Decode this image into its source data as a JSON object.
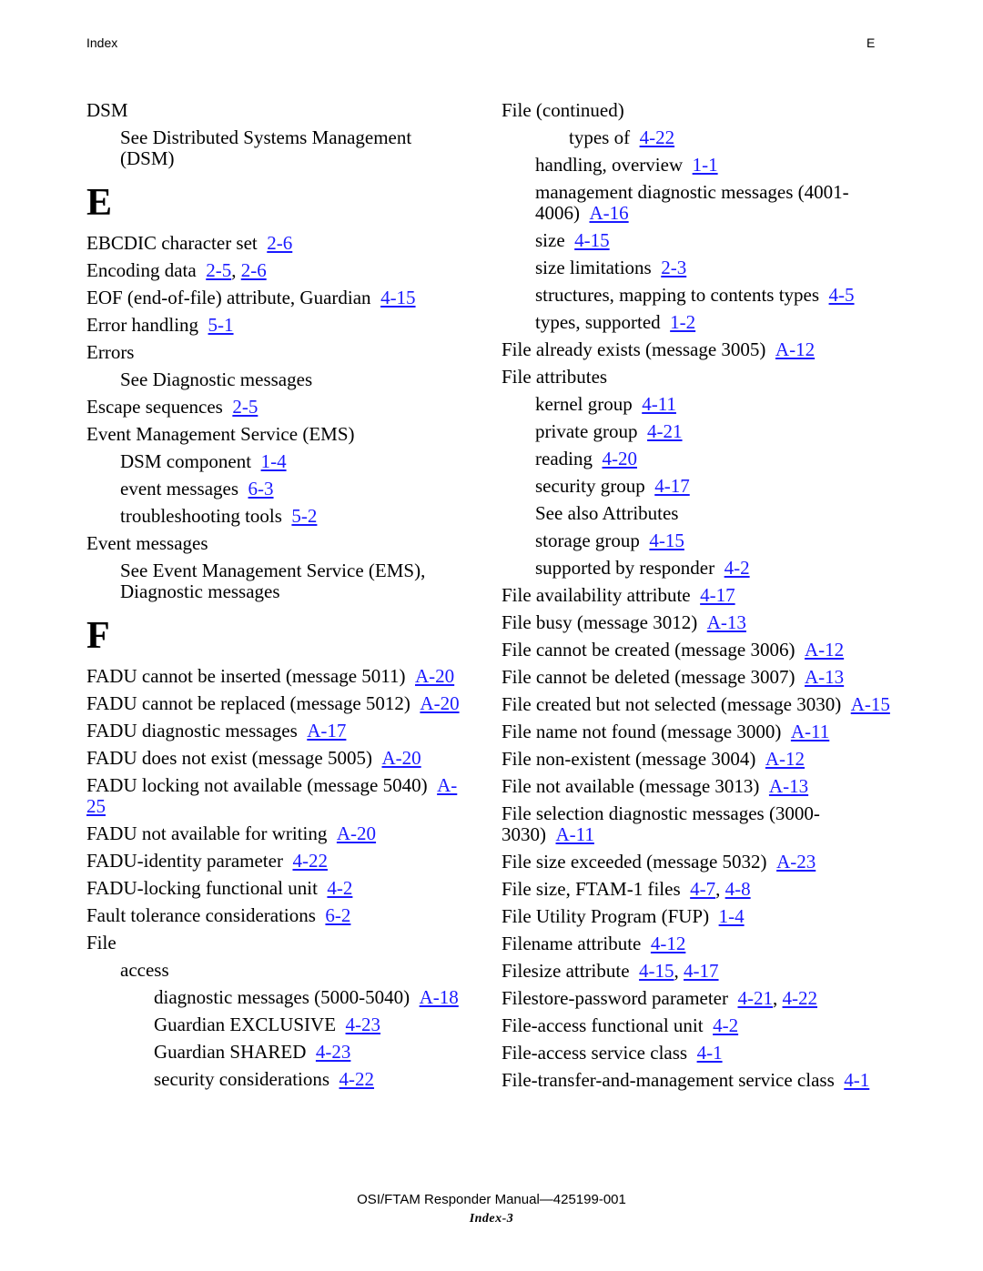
{
  "header": {
    "left": "Index",
    "right": "E"
  },
  "left_column": [
    {
      "type": "entry",
      "level": 1,
      "text": "DSM",
      "refs": []
    },
    {
      "type": "entry",
      "level": 2,
      "text": "See Distributed Systems Management (DSM)",
      "refs": []
    },
    {
      "type": "letter",
      "text": "E"
    },
    {
      "type": "entry",
      "level": 1,
      "text": "EBCDIC character set",
      "refs": [
        "2-6"
      ]
    },
    {
      "type": "entry",
      "level": 1,
      "text": "Encoding data",
      "refs": [
        "2-5",
        "2-6"
      ]
    },
    {
      "type": "entry",
      "level": 1,
      "text": "EOF (end-of-file) attribute, Guardian",
      "refs": [
        "4-15"
      ]
    },
    {
      "type": "entry",
      "level": 1,
      "text": "Error handling",
      "refs": [
        "5-1"
      ]
    },
    {
      "type": "entry",
      "level": 1,
      "text": "Errors",
      "refs": []
    },
    {
      "type": "entry",
      "level": 2,
      "text": "See Diagnostic messages",
      "refs": []
    },
    {
      "type": "entry",
      "level": 1,
      "text": "Escape sequences",
      "refs": [
        "2-5"
      ]
    },
    {
      "type": "entry",
      "level": 1,
      "text": "Event Management Service (EMS)",
      "refs": []
    },
    {
      "type": "entry",
      "level": 2,
      "text": "DSM component",
      "refs": [
        "1-4"
      ]
    },
    {
      "type": "entry",
      "level": 2,
      "text": "event messages",
      "refs": [
        "6-3"
      ]
    },
    {
      "type": "entry",
      "level": 2,
      "text": "troubleshooting tools",
      "refs": [
        "5-2"
      ]
    },
    {
      "type": "entry",
      "level": 1,
      "text": "Event messages",
      "refs": []
    },
    {
      "type": "entry",
      "level": 2,
      "text": "See Event Management Service (EMS), Diagnostic messages",
      "refs": []
    },
    {
      "type": "letter",
      "text": "F"
    },
    {
      "type": "entry",
      "level": 1,
      "text": "FADU cannot be inserted (message 5011)",
      "refs": [
        "A-20"
      ]
    },
    {
      "type": "entry",
      "level": 1,
      "text": "FADU cannot be replaced (message 5012)",
      "refs": [
        "A-20"
      ]
    },
    {
      "type": "entry",
      "level": 1,
      "text": "FADU diagnostic messages",
      "refs": [
        "A-17"
      ]
    },
    {
      "type": "entry",
      "level": 1,
      "text": "FADU does not exist (message 5005)",
      "refs": [
        "A-20"
      ]
    },
    {
      "type": "entry",
      "level": 1,
      "text": "FADU locking not available (message 5040)",
      "refs": [
        "A-25"
      ]
    },
    {
      "type": "entry",
      "level": 1,
      "text": "FADU not available for writing",
      "refs": [
        "A-20"
      ]
    },
    {
      "type": "entry",
      "level": 1,
      "text": "FADU-identity parameter",
      "refs": [
        "4-22"
      ]
    },
    {
      "type": "entry",
      "level": 1,
      "text": "FADU-locking functional unit",
      "refs": [
        "4-2"
      ]
    },
    {
      "type": "entry",
      "level": 1,
      "text": "Fault tolerance considerations",
      "refs": [
        "6-2"
      ]
    },
    {
      "type": "entry",
      "level": 1,
      "text": "File",
      "refs": []
    },
    {
      "type": "entry",
      "level": 2,
      "text": "access",
      "refs": []
    },
    {
      "type": "entry",
      "level": 3,
      "text": "diagnostic messages (5000-5040)",
      "refs": [
        "A-18"
      ]
    },
    {
      "type": "entry",
      "level": 3,
      "text": "Guardian EXCLUSIVE",
      "refs": [
        "4-23"
      ]
    },
    {
      "type": "entry",
      "level": 3,
      "text": "Guardian SHARED",
      "refs": [
        "4-23"
      ]
    },
    {
      "type": "entry",
      "level": 3,
      "text": "security considerations",
      "refs": [
        "4-22"
      ]
    }
  ],
  "right_column": [
    {
      "type": "entry",
      "level": 1,
      "text": "File  (continued)",
      "refs": []
    },
    {
      "type": "entry",
      "level": 3,
      "text": "types of",
      "refs": [
        "4-22"
      ]
    },
    {
      "type": "entry",
      "level": 2,
      "text": "handling, overview",
      "refs": [
        "1-1"
      ]
    },
    {
      "type": "entry",
      "level": 2,
      "text": "management diagnostic messages (4001-4006)",
      "refs": [
        "A-16"
      ]
    },
    {
      "type": "entry",
      "level": 2,
      "text": "size",
      "refs": [
        "4-15"
      ]
    },
    {
      "type": "entry",
      "level": 2,
      "text": "size limitations",
      "refs": [
        "2-3"
      ]
    },
    {
      "type": "entry",
      "level": 2,
      "text": "structures, mapping to contents types",
      "refs": [
        "4-5"
      ]
    },
    {
      "type": "entry",
      "level": 2,
      "text": "types, supported",
      "refs": [
        "1-2"
      ]
    },
    {
      "type": "entry",
      "level": 1,
      "text": "File already exists (message 3005)",
      "refs": [
        "A-12"
      ]
    },
    {
      "type": "entry",
      "level": 1,
      "text": "File attributes",
      "refs": []
    },
    {
      "type": "entry",
      "level": 2,
      "text": "kernel group",
      "refs": [
        "4-11"
      ]
    },
    {
      "type": "entry",
      "level": 2,
      "text": "private group",
      "refs": [
        "4-21"
      ]
    },
    {
      "type": "entry",
      "level": 2,
      "text": "reading",
      "refs": [
        "4-20"
      ]
    },
    {
      "type": "entry",
      "level": 2,
      "text": "security group",
      "refs": [
        "4-17"
      ]
    },
    {
      "type": "entry",
      "level": 2,
      "text": "See also Attributes",
      "refs": []
    },
    {
      "type": "entry",
      "level": 2,
      "text": "storage group",
      "refs": [
        "4-15"
      ]
    },
    {
      "type": "entry",
      "level": 2,
      "text": "supported by responder",
      "refs": [
        "4-2"
      ]
    },
    {
      "type": "entry",
      "level": 1,
      "text": "File availability attribute",
      "refs": [
        "4-17"
      ]
    },
    {
      "type": "entry",
      "level": 1,
      "text": "File busy (message 3012)",
      "refs": [
        "A-13"
      ]
    },
    {
      "type": "entry",
      "level": 1,
      "text": "File cannot be created (message 3006)",
      "refs": [
        "A-12"
      ]
    },
    {
      "type": "entry",
      "level": 1,
      "text": "File cannot be deleted (message 3007)",
      "refs": [
        "A-13"
      ]
    },
    {
      "type": "entry",
      "level": 1,
      "text": "File created but not selected (message 3030)",
      "refs": [
        "A-15"
      ]
    },
    {
      "type": "entry",
      "level": 1,
      "text": "File name not found (message 3000)",
      "refs": [
        "A-11"
      ]
    },
    {
      "type": "entry",
      "level": 1,
      "text": "File non-existent (message 3004)",
      "refs": [
        "A-12"
      ]
    },
    {
      "type": "entry",
      "level": 1,
      "text": "File not available (message 3013)",
      "refs": [
        "A-13"
      ]
    },
    {
      "type": "entry",
      "level": 1,
      "text": "File selection diagnostic messages (3000-3030)",
      "refs": [
        "A-11"
      ]
    },
    {
      "type": "entry",
      "level": 1,
      "text": "File size exceeded (message 5032)",
      "refs": [
        "A-23"
      ]
    },
    {
      "type": "entry",
      "level": 1,
      "text": "File size, FTAM-1 files",
      "refs": [
        "4-7",
        "4-8"
      ]
    },
    {
      "type": "entry",
      "level": 1,
      "text": "File Utility Program (FUP)",
      "refs": [
        "1-4"
      ]
    },
    {
      "type": "entry",
      "level": 1,
      "text": "Filename attribute",
      "refs": [
        "4-12"
      ]
    },
    {
      "type": "entry",
      "level": 1,
      "text": "Filesize attribute",
      "refs": [
        "4-15",
        "4-17"
      ]
    },
    {
      "type": "entry",
      "level": 1,
      "text": "Filestore-password parameter",
      "refs": [
        "4-21",
        "4-22"
      ]
    },
    {
      "type": "entry",
      "level": 1,
      "text": "File-access functional unit",
      "refs": [
        "4-2"
      ]
    },
    {
      "type": "entry",
      "level": 1,
      "text": "File-access service class",
      "refs": [
        "4-1"
      ]
    },
    {
      "type": "entry",
      "level": 1,
      "text": "File-transfer-and-management service class",
      "refs": [
        "4-1"
      ]
    }
  ],
  "footer": {
    "manual_title": "OSI/FTAM Responder Manual—425199-001",
    "page_label": "Index-3"
  },
  "colors": {
    "link": "#1a1aff",
    "text": "#000000"
  }
}
